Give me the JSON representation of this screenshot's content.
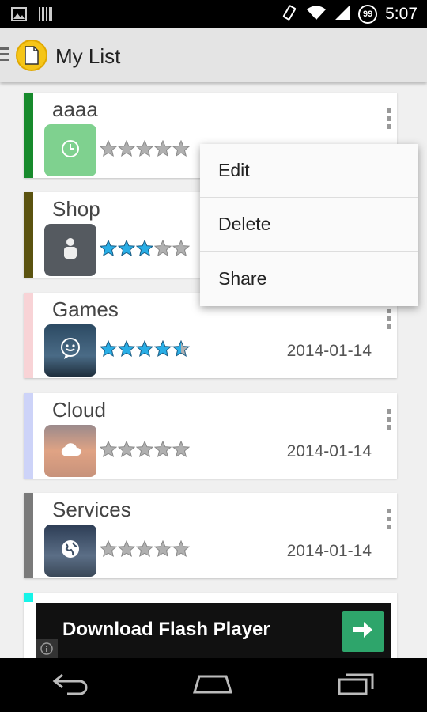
{
  "status_bar": {
    "time": "5:07",
    "notification_count": "99",
    "icons": [
      "image-icon",
      "barcode-icon",
      "vibrate-icon",
      "wifi-icon",
      "signal-icon"
    ]
  },
  "action_bar": {
    "title": "My List"
  },
  "items": [
    {
      "title": "aaaa",
      "date": "",
      "rating": 0,
      "stars_total": 5,
      "strip_color": "#178a2c",
      "thumb": "clock"
    },
    {
      "title": "Shop",
      "date": "",
      "rating": 3,
      "stars_total": 5,
      "strip_color": "#5b5310",
      "thumb": "person"
    },
    {
      "title": "Games",
      "date": "2014-01-14",
      "rating": 4.5,
      "stars_total": 5,
      "strip_color": "#f8d3d6",
      "thumb": "smiley"
    },
    {
      "title": "Cloud",
      "date": "2014-01-14",
      "rating": 0,
      "stars_total": 5,
      "strip_color": "#cdd3f8",
      "thumb": "cloud"
    },
    {
      "title": "Services",
      "date": "2014-01-14",
      "rating": 0,
      "stars_total": 5,
      "strip_color": "#7a7a7a",
      "thumb": "globe"
    }
  ],
  "popup_menu": {
    "items": [
      "Edit",
      "Delete",
      "Share"
    ]
  },
  "ad_banner": {
    "text": "Download Flash Player"
  },
  "nav_bar": {
    "icons": [
      "back-icon",
      "home-icon",
      "recent-apps-icon"
    ]
  },
  "colors": {
    "star_filled": "#29aee6",
    "star_empty": "#b0b0b0",
    "ad_button": "#2ea56b"
  }
}
